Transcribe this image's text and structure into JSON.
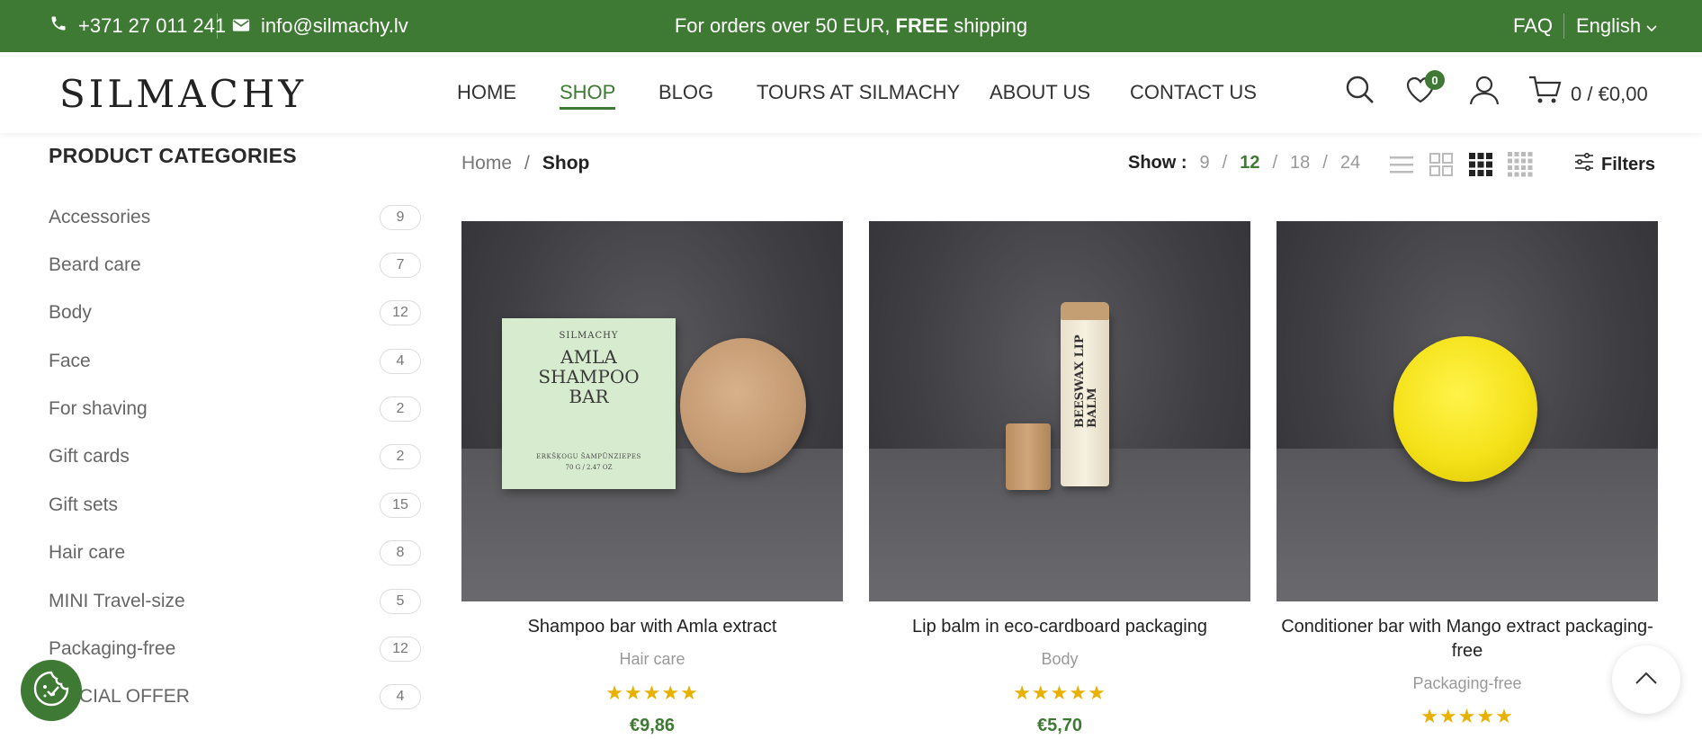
{
  "topbar": {
    "phone": "+371 27 011 241",
    "email": "info@silmachy.lv",
    "promo_text": "For orders over 50 EUR,",
    "promo_bold": "FREE",
    "promo_tail": "shipping",
    "faq": "FAQ",
    "language": "English"
  },
  "header": {
    "logo": "SILMACHY",
    "nav": [
      "HOME",
      "SHOP",
      "BLOG",
      "TOURS AT SILMACHY",
      "ABOUT US",
      "CONTACT US"
    ],
    "active_nav": "SHOP",
    "wishlist_count": "0",
    "cart_count": "0",
    "cart_sep": "/",
    "cart_total": "€0,00"
  },
  "sidebar": {
    "title": "PRODUCT CATEGORIES",
    "categories": [
      {
        "label": "Accessories",
        "count": "9"
      },
      {
        "label": "Beard care",
        "count": "7"
      },
      {
        "label": "Body",
        "count": "12"
      },
      {
        "label": "Face",
        "count": "4"
      },
      {
        "label": "For shaving",
        "count": "2"
      },
      {
        "label": "Gift cards",
        "count": "2"
      },
      {
        "label": "Gift sets",
        "count": "15"
      },
      {
        "label": "Hair care",
        "count": "8"
      },
      {
        "label": "MINI Travel-size",
        "count": "5"
      },
      {
        "label": "Packaging-free",
        "count": "12"
      },
      {
        "label": "CIAL OFFER",
        "count": "4"
      }
    ]
  },
  "toolbar": {
    "breadcrumb": [
      "Home",
      "Shop"
    ],
    "breadcrumb_sep": "/",
    "show_label": "Show :",
    "show_options": [
      "9",
      "12",
      "18",
      "24"
    ],
    "show_selected": "12",
    "filters_label": "Filters"
  },
  "products": [
    {
      "title": "Shampoo bar with Amla extract",
      "category": "Hair care",
      "rating": 5,
      "price": "€9,86",
      "package_brand": "SILMACHY",
      "package_text": "AMLA SHAMPOO BAR",
      "package_sub": "ERKŠĶOGU ŠAMPŪNZIEPES",
      "package_weight": "70 G / 2.47 OZ"
    },
    {
      "title": "Lip balm in eco-cardboard packaging",
      "category": "Body",
      "rating": 5,
      "price": "€5,70",
      "package_text": "BEESWAX LIP BALM"
    },
    {
      "title": "Conditioner bar with Mango extract packaging-free",
      "category": "Packaging-free",
      "rating": 5,
      "price": ""
    }
  ],
  "colors": {
    "brand_green": "#3f7a35",
    "star": "#e8b100"
  },
  "icons": [
    "phone-icon",
    "mail-icon",
    "chevron-down-icon",
    "search-icon",
    "heart-icon",
    "user-icon",
    "cart-icon",
    "list-view-icon",
    "grid-2-icon",
    "grid-3-icon",
    "grid-4-icon",
    "filter-icon",
    "cookie-icon",
    "chevron-up-icon"
  ]
}
